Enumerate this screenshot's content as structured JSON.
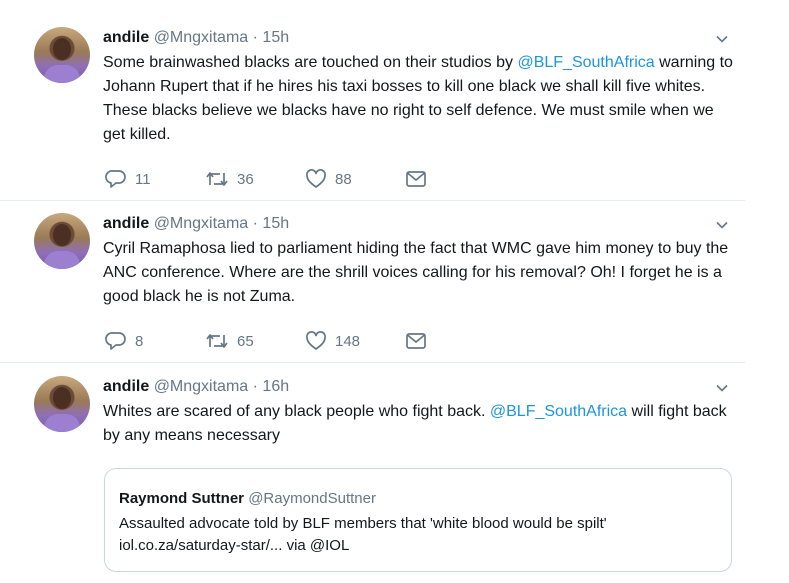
{
  "tweets": [
    {
      "name": "andile",
      "handle": "@Mngxitama",
      "dot": "·",
      "time": "15h",
      "text_a": "Some brainwashed blacks are touched on their studios  by ",
      "mention": "@BLF_SouthAfrica",
      "text_b": " warning to Johann Rupert that if he hires his taxi bosses to kill one black we shall kill five whites. These blacks believe we blacks have no right to self defence. We must smile when we get killed.",
      "replies": "11",
      "retweets": "36",
      "likes": "88"
    },
    {
      "name": "andile",
      "handle": "@Mngxitama",
      "dot": "·",
      "time": "15h",
      "text_a": "Cyril Ramaphosa lied to parliament hiding the fact that WMC gave him money to buy the ANC conference. Where are the shrill voices calling for his removal? Oh! I forget he is a good black he is not Zuma.",
      "replies": "8",
      "retweets": "65",
      "likes": "148"
    },
    {
      "name": "andile",
      "handle": "@Mngxitama",
      "dot": "·",
      "time": "16h",
      "text_a": "Whites are scared of any black people who fight back. ",
      "mention": "@BLF_SouthAfrica",
      "text_b": " will fight back by any means necessary",
      "quote": {
        "name": "Raymond Suttner",
        "handle": "@RaymondSuttner",
        "text": "Assaulted advocate told by BLF members that 'white blood would be spilt' iol.co.za/saturday-star/... via @IOL"
      }
    }
  ],
  "colors": {
    "accent": "#1b95e0",
    "muted": "#657786",
    "border": "#e6ecf0"
  },
  "icons": [
    "reply-icon",
    "retweet-icon",
    "like-icon",
    "message-icon",
    "chevron-down-icon"
  ]
}
